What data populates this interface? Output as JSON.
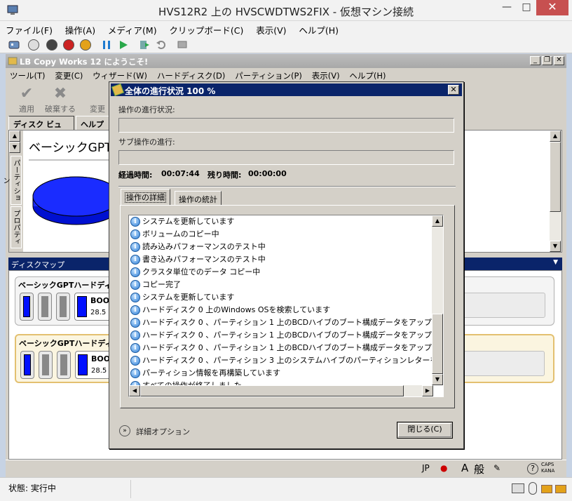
{
  "vm": {
    "title": "HVS12R2 上の HVSCWDTWS2FIX  - 仮想マシン接続",
    "menu": [
      "ファイル(F)",
      "操作(A)",
      "メディア(M)",
      "クリップボード(C)",
      "表示(V)",
      "ヘルプ(H)"
    ],
    "status_label": "状態: 実行中",
    "ime": {
      "lang": "JP",
      "mode_char": "A",
      "general": "般",
      "caps": "CAPS",
      "kana": "KANA"
    }
  },
  "app": {
    "title": "LB Copy Works 12 にようこそ!",
    "menu": [
      "ツール(T)",
      "変更(C)",
      "ウィザード(W)",
      "ハードディスク(D)",
      "パーティション(P)",
      "表示(V)",
      "ヘルプ(H)"
    ],
    "tools": {
      "apply": "適用",
      "discard": "破棄する",
      "change": "変更"
    },
    "tabs": {
      "disk_view": "ディスク ビュー",
      "help": "ヘルプ"
    },
    "vtabs": {
      "partition": "パーティション",
      "property": "プロパティ"
    },
    "disk_view_heading": "ベーシックGPTハ",
    "diskmap_title": "ディスクマップ",
    "disks": [
      {
        "title": "ベーシックGPTハードディス",
        "part_name": "BOO",
        "part_size": "28.5"
      },
      {
        "title": "ベーシックGPTハードディス",
        "part_name": "BOO",
        "part_size": "28.5"
      }
    ]
  },
  "dialog": {
    "title": "全体の進行状況 100 %",
    "op_progress_label": "操作の進行状況:",
    "subop_progress_label": "サブ操作の進行:",
    "elapsed_label": "経過時間:",
    "elapsed_value": "00:07:44",
    "remaining_label": "残り時間:",
    "remaining_value": "00:00:00",
    "tab_details": "操作の詳細",
    "tab_stats": "操作の統計",
    "log": [
      "システムを更新しています",
      "ボリュームのコピー中",
      "読み込みパフォーマンスのテスト中",
      "書き込みパフォーマンスのテスト中",
      "クラスタ単位でのデータ コピー中",
      "コピー完了",
      "システムを更新しています",
      "ハードディスク 0 上のWindows OSを検索しています",
      "ハードディスク 0 、パーティション 1 上のBCDハイブのブート構成データをアップデート中",
      "ハードディスク 0 、パーティション 1 上のBCDハイブのブート構成データをアップデート中",
      "ハードディスク 0 、パーティション 1 上のBCDハイブのブート構成データをアップデート中",
      "ハードディスク 0 、パーティション 3 上のシステムハイブのパーティションレターをアップデート中",
      "パーティション情報を再構築しています",
      "すべての操作が終了しました"
    ],
    "advanced_options": "詳細オプション",
    "close_button": "閉じる(C)"
  },
  "colors": {
    "title_active": "#0a246a",
    "info_icon": "#2f7fd6",
    "partition_fill": "#0010ff"
  }
}
